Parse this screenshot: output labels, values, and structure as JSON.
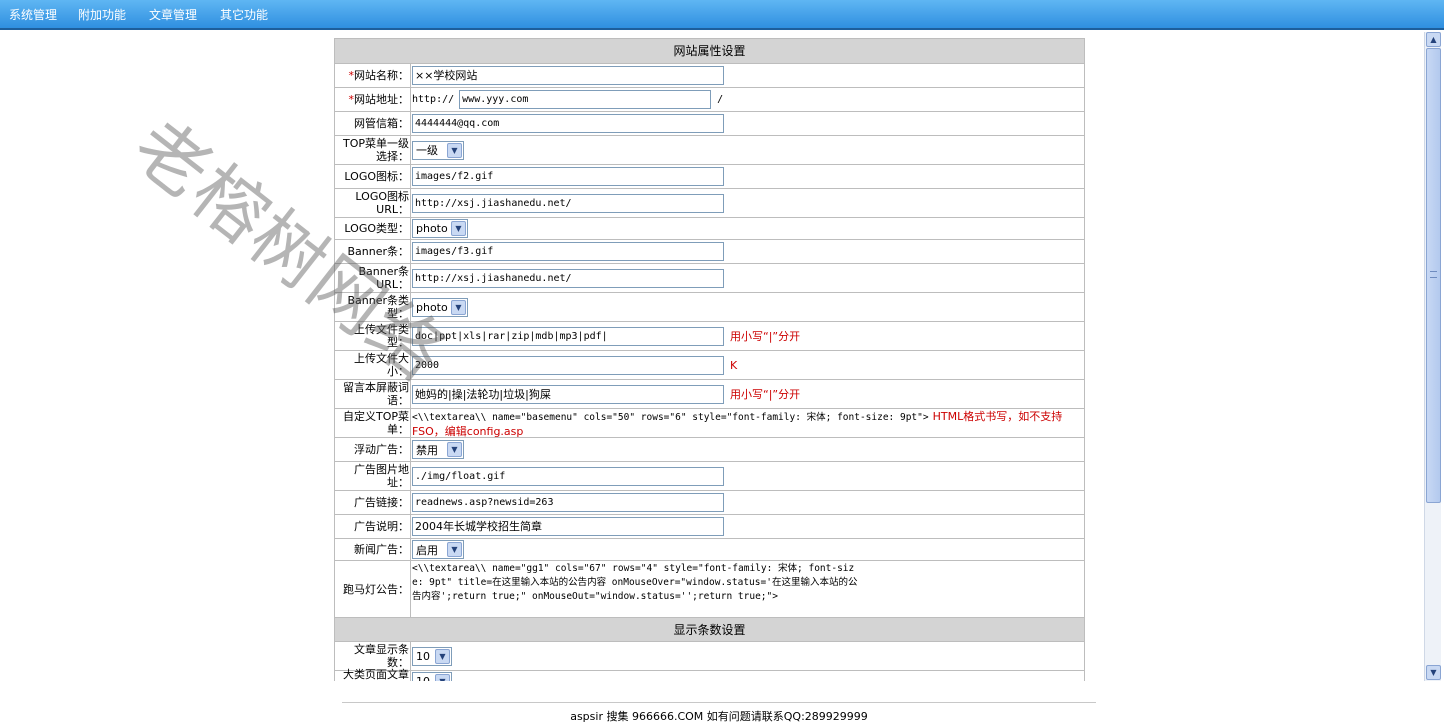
{
  "nav": [
    "系统管理",
    "附加功能",
    "文章管理",
    "其它功能"
  ],
  "section1": {
    "title": "网站属性设置",
    "rows": [
      {
        "label": "网站名称：",
        "required": true,
        "type": "input",
        "value": "××学校网站",
        "cn": true
      },
      {
        "label": "网站地址：",
        "required": true,
        "type": "url",
        "prefix": "http://",
        "value": "www.yyy.com",
        "suffix": "/"
      },
      {
        "label": "网管信箱：",
        "type": "input",
        "value": "4444444@qq.com"
      },
      {
        "label": "TOP菜单一级选择：",
        "type": "select",
        "value": "一级"
      },
      {
        "label": "LOGO图标：",
        "type": "input",
        "value": "images/f2.gif"
      },
      {
        "label": "LOGO图标URL：",
        "type": "input",
        "value": "http://xsj.jiashanedu.net/"
      },
      {
        "label": "LOGO类型：",
        "type": "select",
        "value": "photo"
      },
      {
        "label": "Banner条：",
        "type": "input",
        "value": "images/f3.gif"
      },
      {
        "label": "Banner条URL：",
        "type": "input",
        "value": "http://xsj.jiashanedu.net/"
      },
      {
        "label": "Banner条类型：",
        "type": "select",
        "value": "photo"
      },
      {
        "label": "上传文件类型：",
        "type": "input",
        "value": "doc|ppt|xls|rar|zip|mdb|mp3|pdf|",
        "hint": "用小写“|”分开"
      },
      {
        "label": "上传文件大小：",
        "type": "input",
        "value": "2000",
        "hint": "K"
      },
      {
        "label": "留言本屏蔽词语：",
        "type": "input",
        "value": "她妈的|操|法轮功|垃圾|狗屎",
        "cn": true,
        "hint": "用小写“|”分开"
      },
      {
        "label": "自定义TOP菜单：",
        "type": "raw",
        "value": "<\\\\textarea\\\\ name=\"basemenu\" cols=\"50\" rows=\"6\" style=\"font-family: 宋体; font-size: 9pt\">",
        "hint": "HTML格式书写，如不支持FSO，编辑config.asp"
      },
      {
        "label": "浮动广告：",
        "type": "select",
        "value": "禁用"
      },
      {
        "label": "广告图片地址：",
        "type": "input",
        "value": "./img/float.gif"
      },
      {
        "label": "广告链接：",
        "type": "input",
        "value": "readnews.asp?newsid=263"
      },
      {
        "label": "广告说明：",
        "type": "input",
        "value": "2004年长城学校招生简章",
        "cn": true
      },
      {
        "label": "新闻广告：",
        "type": "select",
        "value": "启用"
      },
      {
        "label": "跑马灯公告：",
        "type": "raw4",
        "value": "<\\\\textarea\\\\ name=\"gg1\" cols=\"67\" rows=\"4\" style=\"font-family: 宋体; font-size: 9pt\" title=在这里输入本站的公告内容 onMouseOver=\"window.status='在这里输入本站的公告内容';return true;\" onMouseOut=\"window.status='';return true;\">"
      }
    ]
  },
  "section2": {
    "title": "显示条数设置",
    "rows": [
      {
        "label": "文章显示条数：",
        "type": "select",
        "value": "10"
      },
      {
        "label": "大类页面文章显示条数：",
        "type": "select",
        "value": "10"
      }
    ]
  },
  "footer": "aspsir 搜集 966666.COM 如有问题请联系QQ:289929999",
  "watermark": "老榕树网络",
  "colors": {
    "nav_bg": "#3a9ae8",
    "header_bg": "#d4d4d4",
    "hint": "#cc0000"
  }
}
